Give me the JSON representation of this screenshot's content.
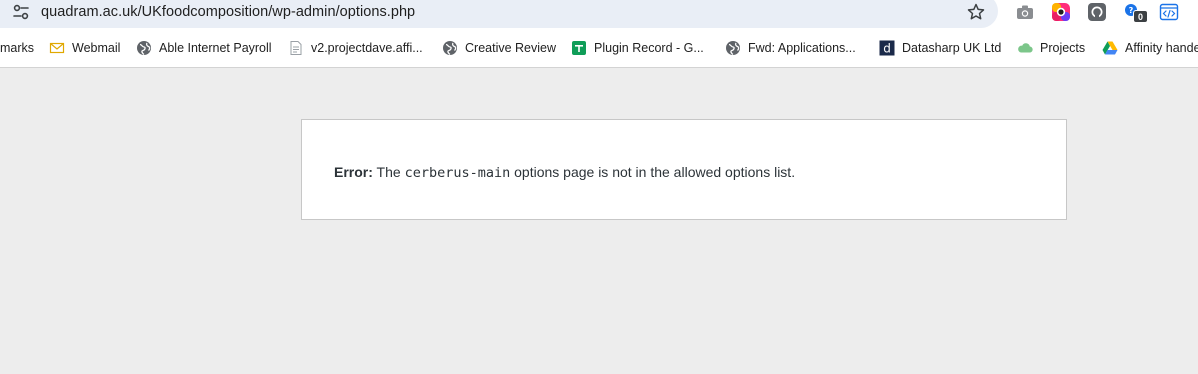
{
  "browser": {
    "url": "quadram.ac.uk/UKfoodcomposition/wp-admin/options.php",
    "extensions": [
      {
        "name": "camera-icon"
      },
      {
        "name": "color-wheel-icon"
      },
      {
        "name": "github-icon"
      },
      {
        "name": "counter-icon",
        "badge": "0"
      },
      {
        "name": "code-icon"
      }
    ]
  },
  "bookmarks": [
    {
      "label": "marks",
      "icon": "none"
    },
    {
      "label": "Webmail",
      "icon": "mail-icon"
    },
    {
      "label": "Able Internet Payroll",
      "icon": "globe-icon"
    },
    {
      "label": "v2.projectdave.affi...",
      "icon": "document-icon"
    },
    {
      "label": "Creative Review",
      "icon": "globe-icon"
    },
    {
      "label": "Plugin Record - G...",
      "icon": "sheets-icon"
    },
    {
      "label": "Fwd: Applications...",
      "icon": "globe-icon"
    },
    {
      "label": "Datasharp UK Ltd",
      "icon": "datasharp-icon"
    },
    {
      "label": "Projects",
      "icon": "cloud-icon"
    },
    {
      "label": "Affinity hande",
      "icon": "drive-icon"
    }
  ],
  "error": {
    "prefix": "Error:",
    "before": "The",
    "code": "cerberus-main",
    "after": "options page is not in the allowed options list."
  },
  "colors": {
    "page_background": "#ededed",
    "omnibox_background": "#e9eef6",
    "panel_background": "#ffffff",
    "panel_border": "#c7c7c7"
  }
}
